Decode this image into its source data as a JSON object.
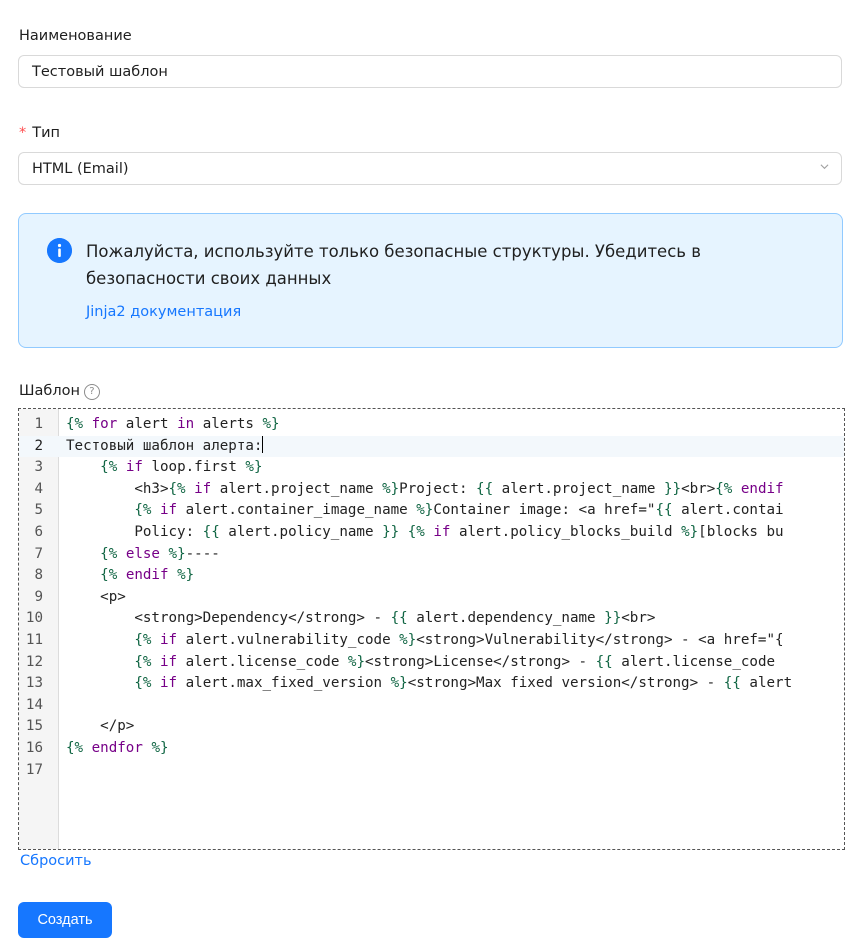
{
  "form": {
    "name_label": "Наименование",
    "name_value": "Тестовый шаблон",
    "type_required_mark": "*",
    "type_label": "Тип",
    "type_value": "HTML (Email)",
    "alert_icon": "info-icon",
    "alert_message": "Пожалуйста, используйте только безопасные структуры. Убедитесь в безопасности своих данных",
    "alert_link": "Jinja2 документация",
    "template_label": "Шаблон",
    "help_icon": "question-circle-icon",
    "reset_link": "Сбросить",
    "submit_button": "Создать"
  },
  "colors": {
    "primary": "#1677ff",
    "alert_bg": "#e6f4ff",
    "alert_border": "#91caff",
    "required": "#ff4d4f",
    "jinja_delim": "#116644",
    "jinja_keyword": "#770088"
  },
  "editor": {
    "active_line": 2,
    "lines": [
      "{% for alert in alerts %}",
      "Тестовый шаблон алерта:",
      "    {% if loop.first %}",
      "        <h3>{% if alert.project_name %}Project: {{ alert.project_name }}<br>{% endif",
      "        {% if alert.container_image_name %}Container image: <a href=\"{{ alert.contai",
      "        Policy: {{ alert.policy_name }} {% if alert.policy_blocks_build %}[blocks bu",
      "    {% else %}----",
      "    {% endif %}",
      "    <p>",
      "        <strong>Dependency</strong> - {{ alert.dependency_name }}<br>",
      "        {% if alert.vulnerability_code %}<strong>Vulnerability</strong> - <a href=\"{",
      "        {% if alert.license_code %}<strong>License</strong> - {{ alert.license_code ",
      "        {% if alert.max_fixed_version %}<strong>Max fixed version</strong> - {{ alert",
      "",
      "    </p>",
      "{% endfor %}",
      ""
    ]
  }
}
